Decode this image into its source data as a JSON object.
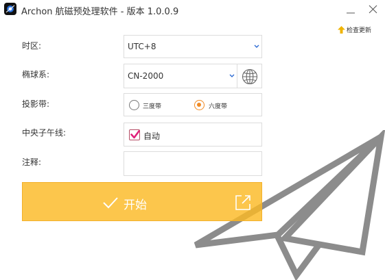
{
  "window": {
    "title": "Archon 航磁预处理软件 - 版本 1.0.0.9",
    "update_link": "检查更新"
  },
  "form": {
    "timezone": {
      "label": "时区:",
      "value": "UTC+8"
    },
    "ellipsoid": {
      "label": "椭球系:",
      "value": "CN-2000"
    },
    "projection_zone": {
      "label": "投影带:",
      "options": [
        "三度带",
        "六度带"
      ],
      "selected": "六度带"
    },
    "central_meridian": {
      "label": "中央子午线:",
      "checkbox_label": "自动",
      "checked": true
    },
    "note": {
      "label": "注释:",
      "value": ""
    }
  },
  "start_button": {
    "label": "开始"
  },
  "colors": {
    "accent_orange": "#f08a24",
    "start_button": "#fbb925",
    "checkbox_check": "#e0207a",
    "plane_gray": "#8c8c8c"
  },
  "icons": [
    "app-logo-icon",
    "minimize-icon",
    "close-icon",
    "up-arrow-icon",
    "chevron-down-icon",
    "globe-icon",
    "checkmark-icon",
    "export-icon",
    "paper-plane-icon"
  ]
}
